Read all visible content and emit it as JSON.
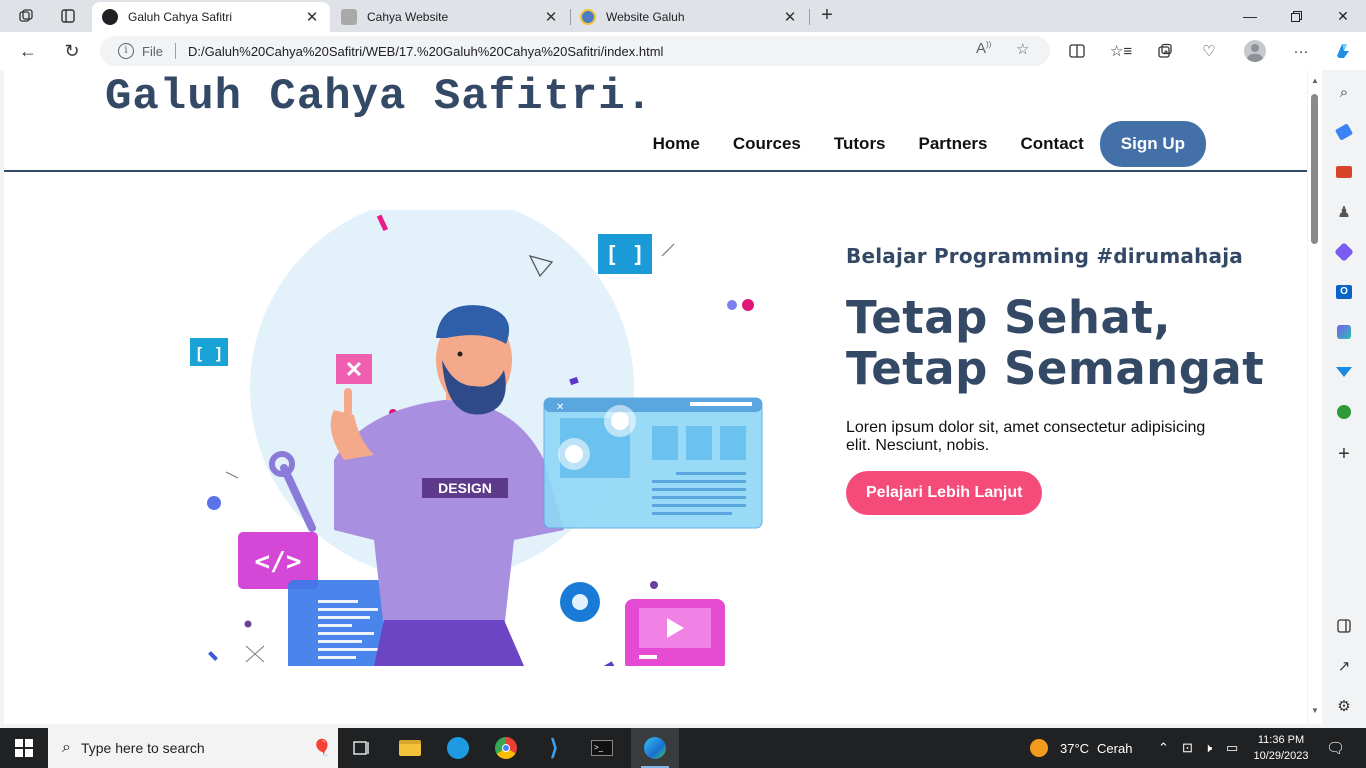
{
  "browser": {
    "tabs": [
      {
        "title": "Galuh Cahya Safitri",
        "active": true
      },
      {
        "title": "Cahya Website",
        "active": false
      },
      {
        "title": "Website Galuh",
        "active": false
      }
    ],
    "address": {
      "scheme_label": "File",
      "url": "D:/Galuh%20Cahya%20Safitri/WEB/17.%20Galuh%20Cahya%20Safitri/index.html"
    }
  },
  "site": {
    "brand": "Galuh Cahya Safitri.",
    "nav": [
      "Home",
      "Cources",
      "Tutors",
      "Partners",
      "Contact"
    ],
    "signup_label": "Sign Up",
    "hero": {
      "eyebrow": "Belajar Programming #dirumahaja",
      "headline_line1": "Tetap Sehat,",
      "headline_line2": "Tetap Semangat",
      "description": "Loren ipsum dolor sit, amet consectetur adipisicing elit. Nesciunt, nobis.",
      "cta_label": "Pelajari Lebih Lanjut",
      "illustration_text": "DESIGN"
    },
    "colors": {
      "brand": "#344966",
      "signup": "#4470a8",
      "cta": "#f54b7b"
    }
  },
  "taskbar": {
    "search_placeholder": "Type here to search",
    "weather": {
      "temp": "37°C",
      "condition": "Cerah"
    },
    "clock": {
      "time": "11:36 PM",
      "date": "10/29/2023"
    }
  }
}
